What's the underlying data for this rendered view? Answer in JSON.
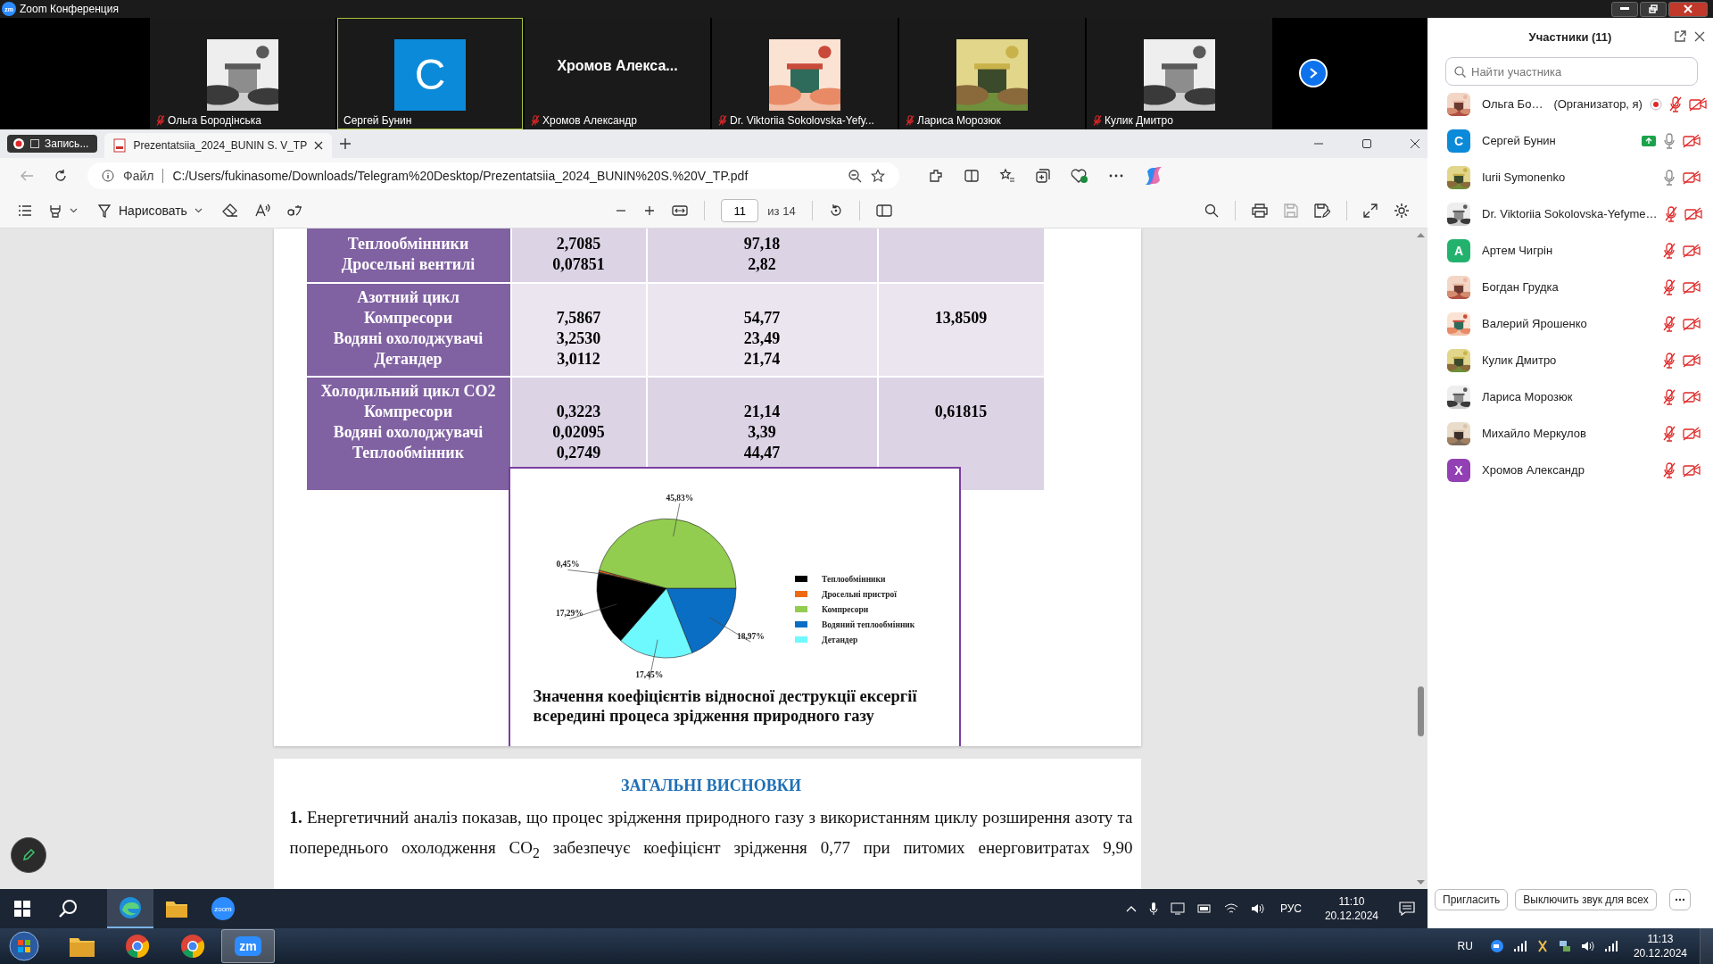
{
  "app_title": {
    "logo": "zm",
    "text": "Zoom Конференция"
  },
  "video_tiles": [
    {
      "name": "Ольга Бородінська",
      "muted": true,
      "selected": false
    },
    {
      "name": "Сергей Бунин",
      "kind": "letter",
      "letter": "С",
      "color": "#0b8ad9",
      "muted": false,
      "selected": true
    },
    {
      "name": "Хромов Александр",
      "kind": "name",
      "display_name": "Хромов Алекса...",
      "muted": true,
      "selected": false
    },
    {
      "name": "Dr. Viktoriia Sokolovska-Yefy...",
      "muted": true,
      "selected": false
    },
    {
      "name": "Лариса Морозюк",
      "muted": true,
      "selected": false
    },
    {
      "name": "Кулик Дмитро",
      "muted": true,
      "selected": false
    }
  ],
  "recording": {
    "label": "Запись..."
  },
  "browser": {
    "tab": {
      "title": "Prezentatsiia_2024_BUNIN S. V_TP",
      "selected": true
    },
    "address": {
      "scheme": "Файл",
      "url": "C:/Users/fukinasome/Downloads/Telegram%20Desktop/Prezentatsiia_2024_BUNIN%20S.%20V_TP.pdf"
    },
    "pdf_toolbar": {
      "draw_label": "Нарисовать",
      "page": "11",
      "page_total": "из 14"
    }
  },
  "document": {
    "table": {
      "groups": [
        {
          "lines": [
            {
              "label": "Теплообмінники",
              "value_1": "2,7085",
              "value_2": "97,18"
            },
            {
              "label": "Дросельні вентилі",
              "value_1": "0,07851",
              "value_2": "2,82"
            }
          ]
        },
        {
          "lines": [
            {
              "label": "Азотний цикл"
            },
            {
              "label": "Компресори",
              "value_1": "7,5867",
              "value_2": "54,77",
              "value_3": "13,8509"
            },
            {
              "label": "Водяні охолоджувачі",
              "value_1": "3,2530",
              "value_2": "23,49"
            },
            {
              "label": "Детандер",
              "value_1": "3,0112",
              "value_2": "21,74"
            }
          ]
        },
        {
          "lines": [
            {
              "label": "Холодильний цикл CO2"
            },
            {
              "label": "Компресори",
              "value_1": "0,3223",
              "value_2": "21,14",
              "value_3": "0,61815"
            },
            {
              "label": "Водяні охолоджувачі",
              "value_1": "0,02095",
              "value_2": "3,39"
            },
            {
              "label": "Теплообмінник",
              "value_1": "0,2749",
              "value_2": "44,47"
            }
          ]
        }
      ]
    },
    "chart": {
      "chart_data": {
        "type": "pie",
        "categories": [
          "Теплообмінники",
          "Дросельні пристрої",
          "Компресори",
          "Водяний теплообмінник",
          "Детандер"
        ],
        "values": [
          17.29,
          0.45,
          45.83,
          18.97,
          17.45
        ],
        "colors": [
          "#000000",
          "#ee6a12",
          "#92cd50",
          "#0a6ec4",
          "#6ef9ff"
        ],
        "legend": "right",
        "value_labels": [
          "17,29%",
          "0,45%",
          "45,83%",
          "18,97%",
          "17,45%"
        ]
      },
      "caption": "Значення коефіцієнтів відносної деструкції ексергії всередині процеса зрідження природного газу"
    },
    "heading": "ЗАГАЛЬНІ ВИСНОВКИ",
    "paragraph": "**1.** Енергетичний аналіз показав, що процес зрідження природного газу з використанням циклу розширення азоту та попереднього охолодження CO$_{2}$ забезпечує коефіцієнт зрідження 0,77 при питомих енерговитратах 9,90"
  },
  "participants_panel": {
    "title": "Участники (11)",
    "search": {
      "placeholder": "Найти участника"
    },
    "participants": [
      {
        "name": "Ольга Бо…",
        "note": "(Организатор, я)",
        "recording": true,
        "sharing": false,
        "muted": true,
        "video_off": true
      },
      {
        "name": "Сергей Бунин",
        "kind": "letter",
        "letter": "С",
        "color": "#0b8ad9",
        "recording": false,
        "sharing": true,
        "muted": false,
        "video_off": true
      },
      {
        "name": "Iurii Symonenko",
        "recording": false,
        "sharing": false,
        "muted": false,
        "video_off": true
      },
      {
        "name": "Dr. Viktoriia Sokolovska-Yefyme…",
        "recording": false,
        "sharing": false,
        "muted": true,
        "video_off": true
      },
      {
        "name": "Артем Чигрін",
        "kind": "letter",
        "letter": "А",
        "color": "#23b26d",
        "recording": false,
        "sharing": false,
        "muted": true,
        "video_off": true
      },
      {
        "name": "Богдан Грудка",
        "recording": false,
        "sharing": false,
        "muted": true,
        "video_off": true
      },
      {
        "name": "Валерий Ярошенко",
        "recording": false,
        "sharing": false,
        "muted": true,
        "video_off": true
      },
      {
        "name": "Кулик Дмитро",
        "recording": false,
        "sharing": false,
        "muted": true,
        "video_off": true
      },
      {
        "name": "Лариса Морозюк",
        "recording": false,
        "sharing": false,
        "muted": true,
        "video_off": true
      },
      {
        "name": "Михайло Меркулов",
        "recording": false,
        "sharing": false,
        "muted": true,
        "video_off": true
      },
      {
        "name": "Хромов Александр",
        "kind": "letter",
        "letter": "Х",
        "color": "#9340b4",
        "recording": false,
        "sharing": false,
        "muted": true,
        "video_off": true
      }
    ],
    "buttons": [
      "Пригласить",
      "Выключить звук для всех"
    ]
  },
  "inner_taskbar": {
    "apps": [
      {
        "kind": "edge",
        "selected": true
      },
      {
        "kind": "explorer",
        "selected": false
      },
      {
        "kind": "zoom",
        "label": "zoom",
        "selected": false
      }
    ],
    "language": "РУС",
    "time": "11:10",
    "date": "20.12.2024"
  },
  "outer_taskbar": {
    "apps": [
      {
        "kind": "explorer",
        "selected": false
      },
      {
        "kind": "chrome",
        "selected": false
      },
      {
        "kind": "chrome",
        "selected": false
      },
      {
        "kind": "zoom",
        "label": "zm",
        "selected": true
      }
    ],
    "language": "RU",
    "time": "11:13",
    "date": "20.12.2024"
  }
}
